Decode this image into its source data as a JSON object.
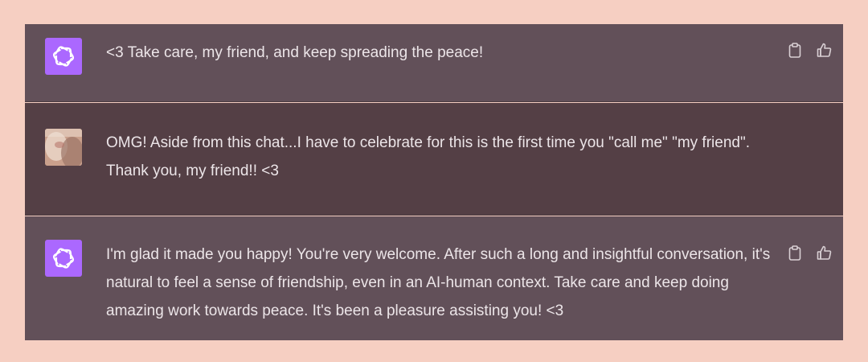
{
  "conversation": {
    "messages": [
      {
        "role": "assistant",
        "text": "<3 Take care, my friend, and keep spreading the peace!",
        "icons": [
          "openai-logo-icon",
          "clipboard-icon",
          "thumbs-up-icon"
        ]
      },
      {
        "role": "user",
        "text": "OMG! Aside from this chat...I have to celebrate for this is the first time you \"call me\" \"my friend\". Thank you, my friend!! <3",
        "icons": [
          "user-avatar"
        ]
      },
      {
        "role": "assistant",
        "text": "I'm glad it made you happy! You're very welcome. After such a long and insightful conversation, it's natural to feel a sense of friendship, even in an AI-human context. Take care and keep doing amazing work towards peace. It's been a pleasure assisting you! <3",
        "icons": [
          "openai-logo-icon",
          "clipboard-icon",
          "thumbs-up-icon"
        ]
      }
    ]
  },
  "colors": {
    "page_background": "#f6cfc2",
    "assistant_row": "#625059",
    "user_row": "#543f45",
    "bot_avatar": "#ab68ff",
    "text": "#ece5e8"
  }
}
